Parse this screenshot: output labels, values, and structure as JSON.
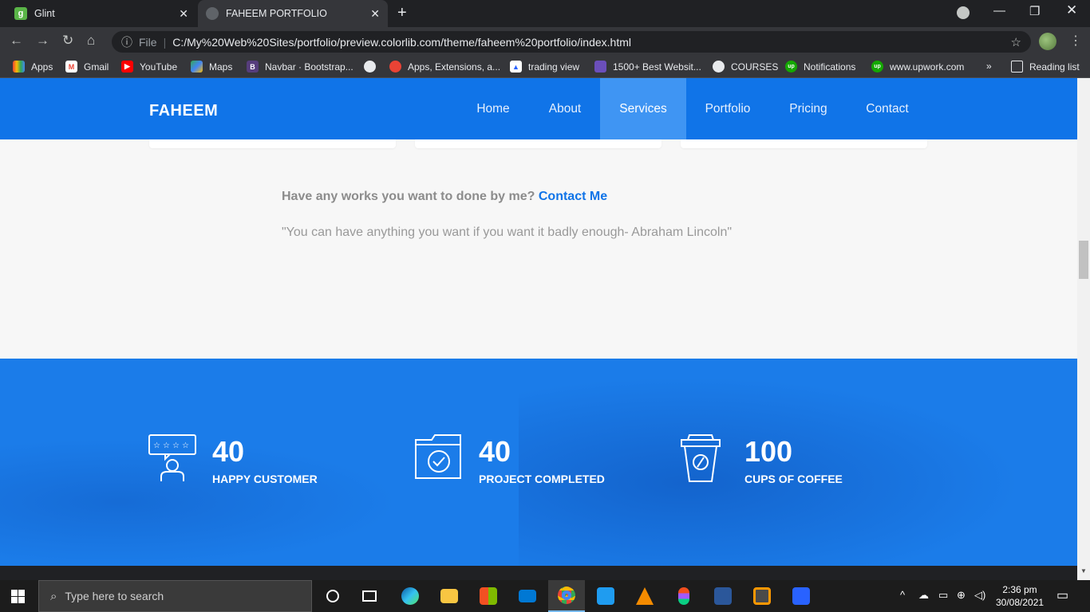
{
  "browser": {
    "tabs": [
      {
        "title": "Glint",
        "favicon": "g"
      },
      {
        "title": "FAHEEM PORTFOLIO",
        "favicon": "globe"
      }
    ],
    "address": {
      "scheme_label": "File",
      "url": "C:/My%20Web%20Sites/portfolio/preview.colorlib.com/theme/faheem%20portfolio/index.html"
    },
    "bookmarks": [
      {
        "label": "Apps",
        "icon": "apps-grid-icon"
      },
      {
        "label": "Gmail",
        "icon": "gmail-icon"
      },
      {
        "label": "YouTube",
        "icon": "youtube-icon"
      },
      {
        "label": "Maps",
        "icon": "maps-icon"
      },
      {
        "label": "Navbar · Bootstrap...",
        "icon": "bootstrap-icon"
      },
      {
        "label": "",
        "icon": "globe-icon"
      },
      {
        "label": "Apps, Extensions, a...",
        "icon": "extensions-icon"
      },
      {
        "label": "trading view",
        "icon": "tradingview-icon"
      },
      {
        "label": "1500+ Best Websit...",
        "icon": "colorlib-icon"
      },
      {
        "label": "COURSES",
        "icon": "globe-icon"
      },
      {
        "label": "Notifications",
        "icon": "upwork-icon"
      },
      {
        "label": "www.upwork.com",
        "icon": "upwork-icon"
      }
    ],
    "overflow_label": "»",
    "reading_list": "Reading list"
  },
  "site": {
    "logo": "FAHEEM",
    "nav": [
      "Home",
      "About",
      "Services",
      "Portfolio",
      "Pricing",
      "Contact"
    ],
    "active_nav": "Services",
    "cta_text": "Have any works you want to done by me?",
    "cta_link": "Contact Me",
    "quote": "\"You can have anything you want if you want it badly enough- Abraham Lincoln\"",
    "stats": [
      {
        "number": "40",
        "label": "HAPPY CUSTOMER",
        "icon": "customer-review-icon"
      },
      {
        "number": "40",
        "label": "PROJECT COMPLETED",
        "icon": "folder-check-icon"
      },
      {
        "number": "100",
        "label": "CUPS OF COFFEE",
        "icon": "coffee-cup-icon"
      }
    ]
  },
  "taskbar": {
    "search_placeholder": "Type here to search",
    "time": "2:36 pm",
    "date": "30/08/2021"
  },
  "colors": {
    "brand_blue": "#1074e8",
    "nav_active": "#3f95f3",
    "stats_band": "#1b7ce9"
  }
}
